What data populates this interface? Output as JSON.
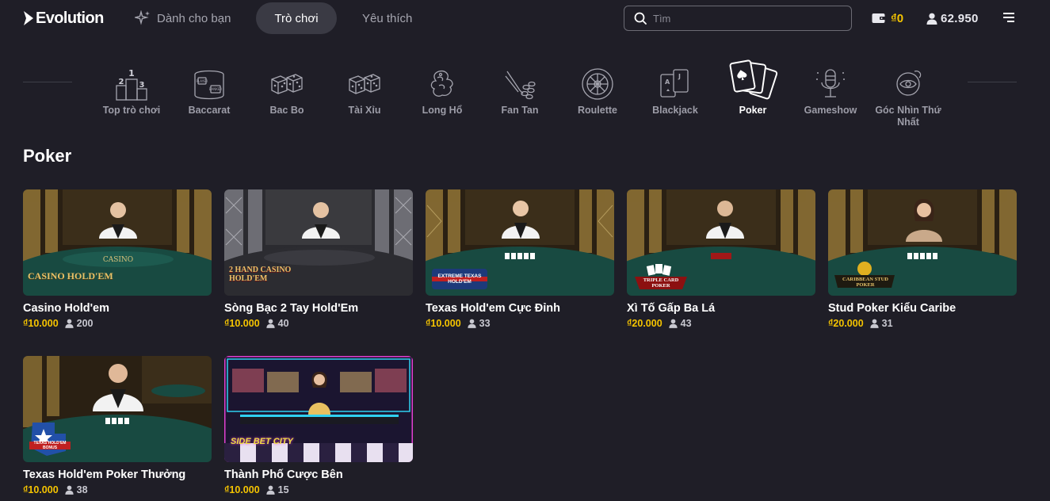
{
  "header": {
    "logo": "Evolution",
    "nav": [
      {
        "label": "Dành cho bạn",
        "icon": "sparkle-icon"
      },
      {
        "label": "Trò chơi",
        "active": true
      },
      {
        "label": "Yêu thích"
      }
    ],
    "search_placeholder": "Tìm",
    "balance": "₫0",
    "players_online": "62.950",
    "accent": "#f5c400"
  },
  "categories": [
    {
      "label": "Top trò chơi",
      "icon": "podium-icon"
    },
    {
      "label": "Baccarat",
      "icon": "baccarat-table-icon"
    },
    {
      "label": "Bac Bo",
      "icon": "dice-icon"
    },
    {
      "label": "Tài Xỉu",
      "icon": "dice-pair-icon"
    },
    {
      "label": "Long Hổ",
      "icon": "dragon-tiger-icon"
    },
    {
      "label": "Fan Tan",
      "icon": "fan-tan-icon"
    },
    {
      "label": "Roulette",
      "icon": "roulette-wheel-icon"
    },
    {
      "label": "Blackjack",
      "icon": "blackjack-cards-icon"
    },
    {
      "label": "Poker",
      "icon": "poker-cards-icon",
      "active": true
    },
    {
      "label": "Gameshow",
      "icon": "microphone-icon"
    },
    {
      "label": "Góc Nhìn Thứ Nhất",
      "icon": "first-person-icon"
    }
  ],
  "section": {
    "title": "Poker",
    "games": [
      {
        "title": "Casino Hold'em",
        "price": "₫10.000",
        "players": "200",
        "logo": "CASINO HOLD'EM"
      },
      {
        "title": "Sòng Bạc 2 Tay Hold'Em",
        "price": "₫10.000",
        "players": "40",
        "logo": "2 HAND CASINO HOLD'EM"
      },
      {
        "title": "Texas Hold'em Cực Đỉnh",
        "price": "₫10.000",
        "players": "33",
        "logo": "EXTREME TEXAS HOLD'EM"
      },
      {
        "title": "Xì Tố Gấp Ba Lá",
        "price": "₫20.000",
        "players": "43",
        "logo": "TRIPLE CARD POKER"
      },
      {
        "title": "Stud Poker Kiểu Caribe",
        "price": "₫20.000",
        "players": "31",
        "logo": "CARIBBEAN STUD POKER"
      },
      {
        "title": "Texas Hold'em Poker Thưởng",
        "price": "₫10.000",
        "players": "38",
        "logo": "TEXAS HOLD'EM BONUS"
      },
      {
        "title": "Thành Phố Cược Bên",
        "price": "₫10.000",
        "players": "15",
        "logo": "SIDE BET CITY"
      }
    ]
  }
}
